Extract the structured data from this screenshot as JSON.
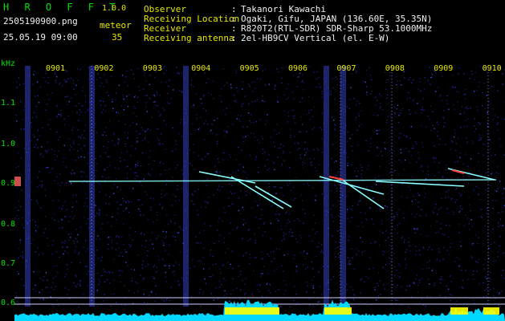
{
  "header": {
    "app_title": "H R O F F T",
    "version": "1.0.0",
    "filename": "2505190900.png",
    "datetime": "25.05.19 09:00",
    "count_label": "meteor",
    "count_value": "35",
    "info": [
      {
        "label": "Observer",
        "value": "Takanori Kawachi"
      },
      {
        "label": "Receiving Location",
        "value": "Ogaki, Gifu, JAPAN (136.60E, 35.35N)"
      },
      {
        "label": "Receiver",
        "value": "R820T2(RTL-SDR) SDR-Sharp 53.1000MHz"
      },
      {
        "label": "Receiving antenna",
        "value": "2el-HB9CV Vertical (el. E-W)"
      }
    ],
    "separator": ":"
  },
  "axis": {
    "y_unit": "kHz",
    "y_ticks": [
      "1.1",
      "1.0",
      "0.9",
      "0.8",
      "0.7",
      "0.6"
    ],
    "x_ticks": [
      "0901",
      "0902",
      "0903",
      "0904",
      "0905",
      "0906",
      "0907",
      "0908",
      "0909",
      "0910"
    ]
  },
  "colors": {
    "background": "#000000",
    "spectrogram_noise": "#1a1a7a",
    "signal_line": "#8affff",
    "meteor_hot": "#ff4040",
    "level_fill": "#00d8ff",
    "level_peak": "#ffff00",
    "label_green": "#00e000",
    "label_yellow": "#e8e800"
  }
}
